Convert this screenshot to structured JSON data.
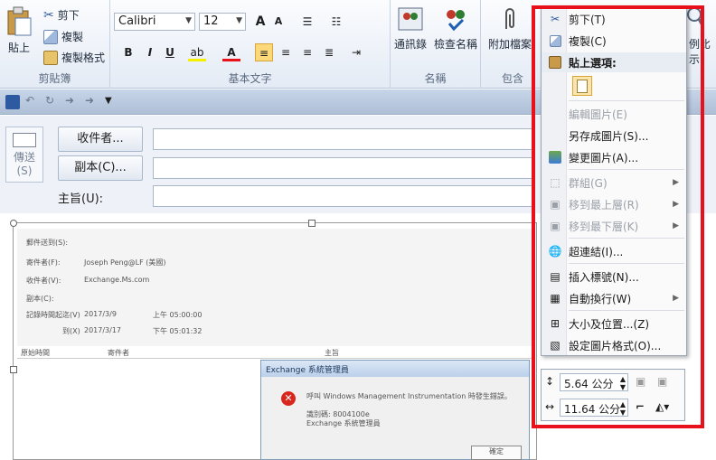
{
  "ribbon": {
    "clipboard": {
      "label": "剪貼簿",
      "paste": "貼上",
      "cut": "剪下",
      "copy": "複製",
      "format_painter": "複製格式"
    },
    "basic_text": {
      "label": "基本文字",
      "font": "Calibri",
      "size": "12",
      "grow": "A",
      "shrink": "A",
      "bold": "B",
      "italic": "I",
      "underline": "U",
      "highlight": "ab",
      "font_color": "A"
    },
    "names": {
      "label": "名稱",
      "address_book": "通訊錄",
      "check_names": "檢查名稱"
    },
    "include": {
      "label": "包含",
      "attach": "附加檔案"
    },
    "zoom_partial": "例比示"
  },
  "form": {
    "send": "傳送",
    "send_key": "(S)",
    "to": "收件者...",
    "cc": "副本(C)...",
    "subject": "主旨(U):"
  },
  "screenshot_text": {
    "fields": [
      "郵件送到(S):",
      "寄件者(F):",
      "收件者(V):",
      "副本(C):",
      "記錄時間起迄(V)",
      "到(X)"
    ],
    "values": [
      "Joseph Peng@LF (美國)",
      "Exchange.Ms.com",
      "2017/3/9",
      "上午 05:00:00",
      "2017/3/17",
      "下午 05:01:32"
    ],
    "columns": [
      "原始時間",
      "寄件者",
      "主旨"
    ],
    "dialog_title": "Exchange 系統管理員",
    "dialog_msg": "呼叫 Windows Management Instrumentation 時發生錯誤。",
    "dialog_id": "識別碼: 8004100e",
    "dialog_src": "Exchange 系統管理員",
    "dialog_ok": "確定"
  },
  "context_menu": {
    "items": [
      {
        "label": "剪下(T)",
        "enabled": true
      },
      {
        "label": "複製(C)",
        "enabled": true
      },
      {
        "label": "貼上選項:",
        "enabled": true
      },
      {
        "label": "編輯圖片(E)",
        "enabled": false
      },
      {
        "label": "另存成圖片(S)...",
        "enabled": true
      },
      {
        "label": "變更圖片(A)...",
        "enabled": true
      },
      {
        "label": "群組(G)",
        "enabled": false
      },
      {
        "label": "移到最上層(R)",
        "enabled": false
      },
      {
        "label": "移到最下層(K)",
        "enabled": false
      },
      {
        "label": "超連結(I)...",
        "enabled": true
      },
      {
        "label": "插入標號(N)...",
        "enabled": true
      },
      {
        "label": "自動換行(W)",
        "enabled": true
      },
      {
        "label": "大小及位置...(Z)",
        "enabled": true
      },
      {
        "label": "設定圖片格式(O)...",
        "enabled": true
      }
    ]
  },
  "mini_toolbar": {
    "height": "5.64 公分",
    "width": "11.64 公分"
  },
  "colors": {
    "highlight": "#e8101a",
    "accent": "#1e5fb4"
  }
}
